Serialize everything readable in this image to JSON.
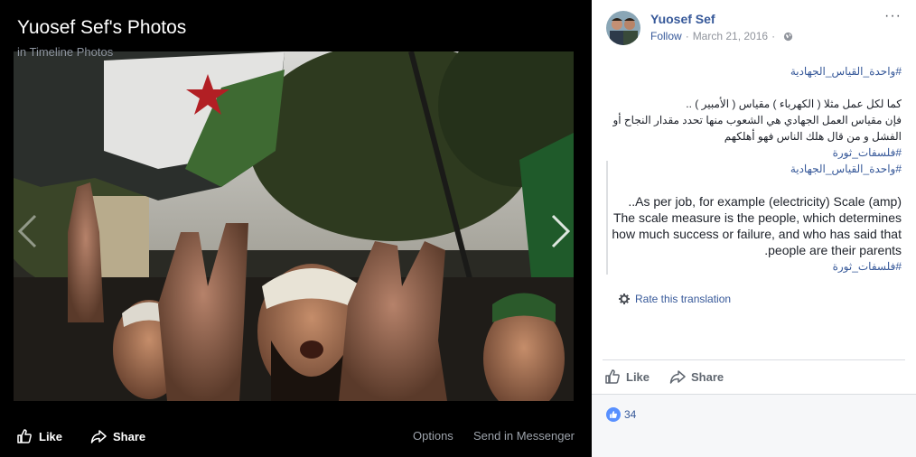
{
  "viewer": {
    "album_title": "Yuosef Sef's Photos",
    "album_subtitle": "in Timeline Photos",
    "like_label": "Like",
    "share_label": "Share",
    "options_label": "Options",
    "messenger_label": "Send in Messenger"
  },
  "post": {
    "author": "Yuosef Sef",
    "follow_label": "Follow",
    "separator": "·",
    "date": "March 21, 2016",
    "more_label": "···",
    "text_tag": "#واحدة_القياس_الجهادية",
    "text_line1": "كما لكل عمل مثلا ( الكهرباء ) مقياس ( الأمبير ) ..",
    "text_line2": "فإن مقياس العمل الجهادي هي الشعوب منها تحدد مقدار النجاح أو الفشل و من قال هلك الناس فهو أهلكهم",
    "text_tag2": "#فلسفات_ثورة",
    "text_tag3": "#واحدة_القياس_الجهادية",
    "translation_line1": "As per job, for example (electricity) Scale (amp)..",
    "translation_line2": "The scale measure is the people, which determines how much success or failure, and who has said that people are their parents.",
    "translation_tag": "#فلسفات_ثورة",
    "rate_label": "Rate this translation",
    "like_label": "Like",
    "share_label": "Share",
    "reaction_count": "34"
  },
  "colors": {
    "link": "#365899",
    "like_badge": "#5890ff",
    "meta": "#90949c"
  },
  "icons": {
    "prev": "chevron-left-icon",
    "next": "chevron-right-icon",
    "like": "thumbs-up-icon",
    "share": "share-arrow-icon",
    "globe": "globe-icon",
    "gear": "gear-icon"
  }
}
